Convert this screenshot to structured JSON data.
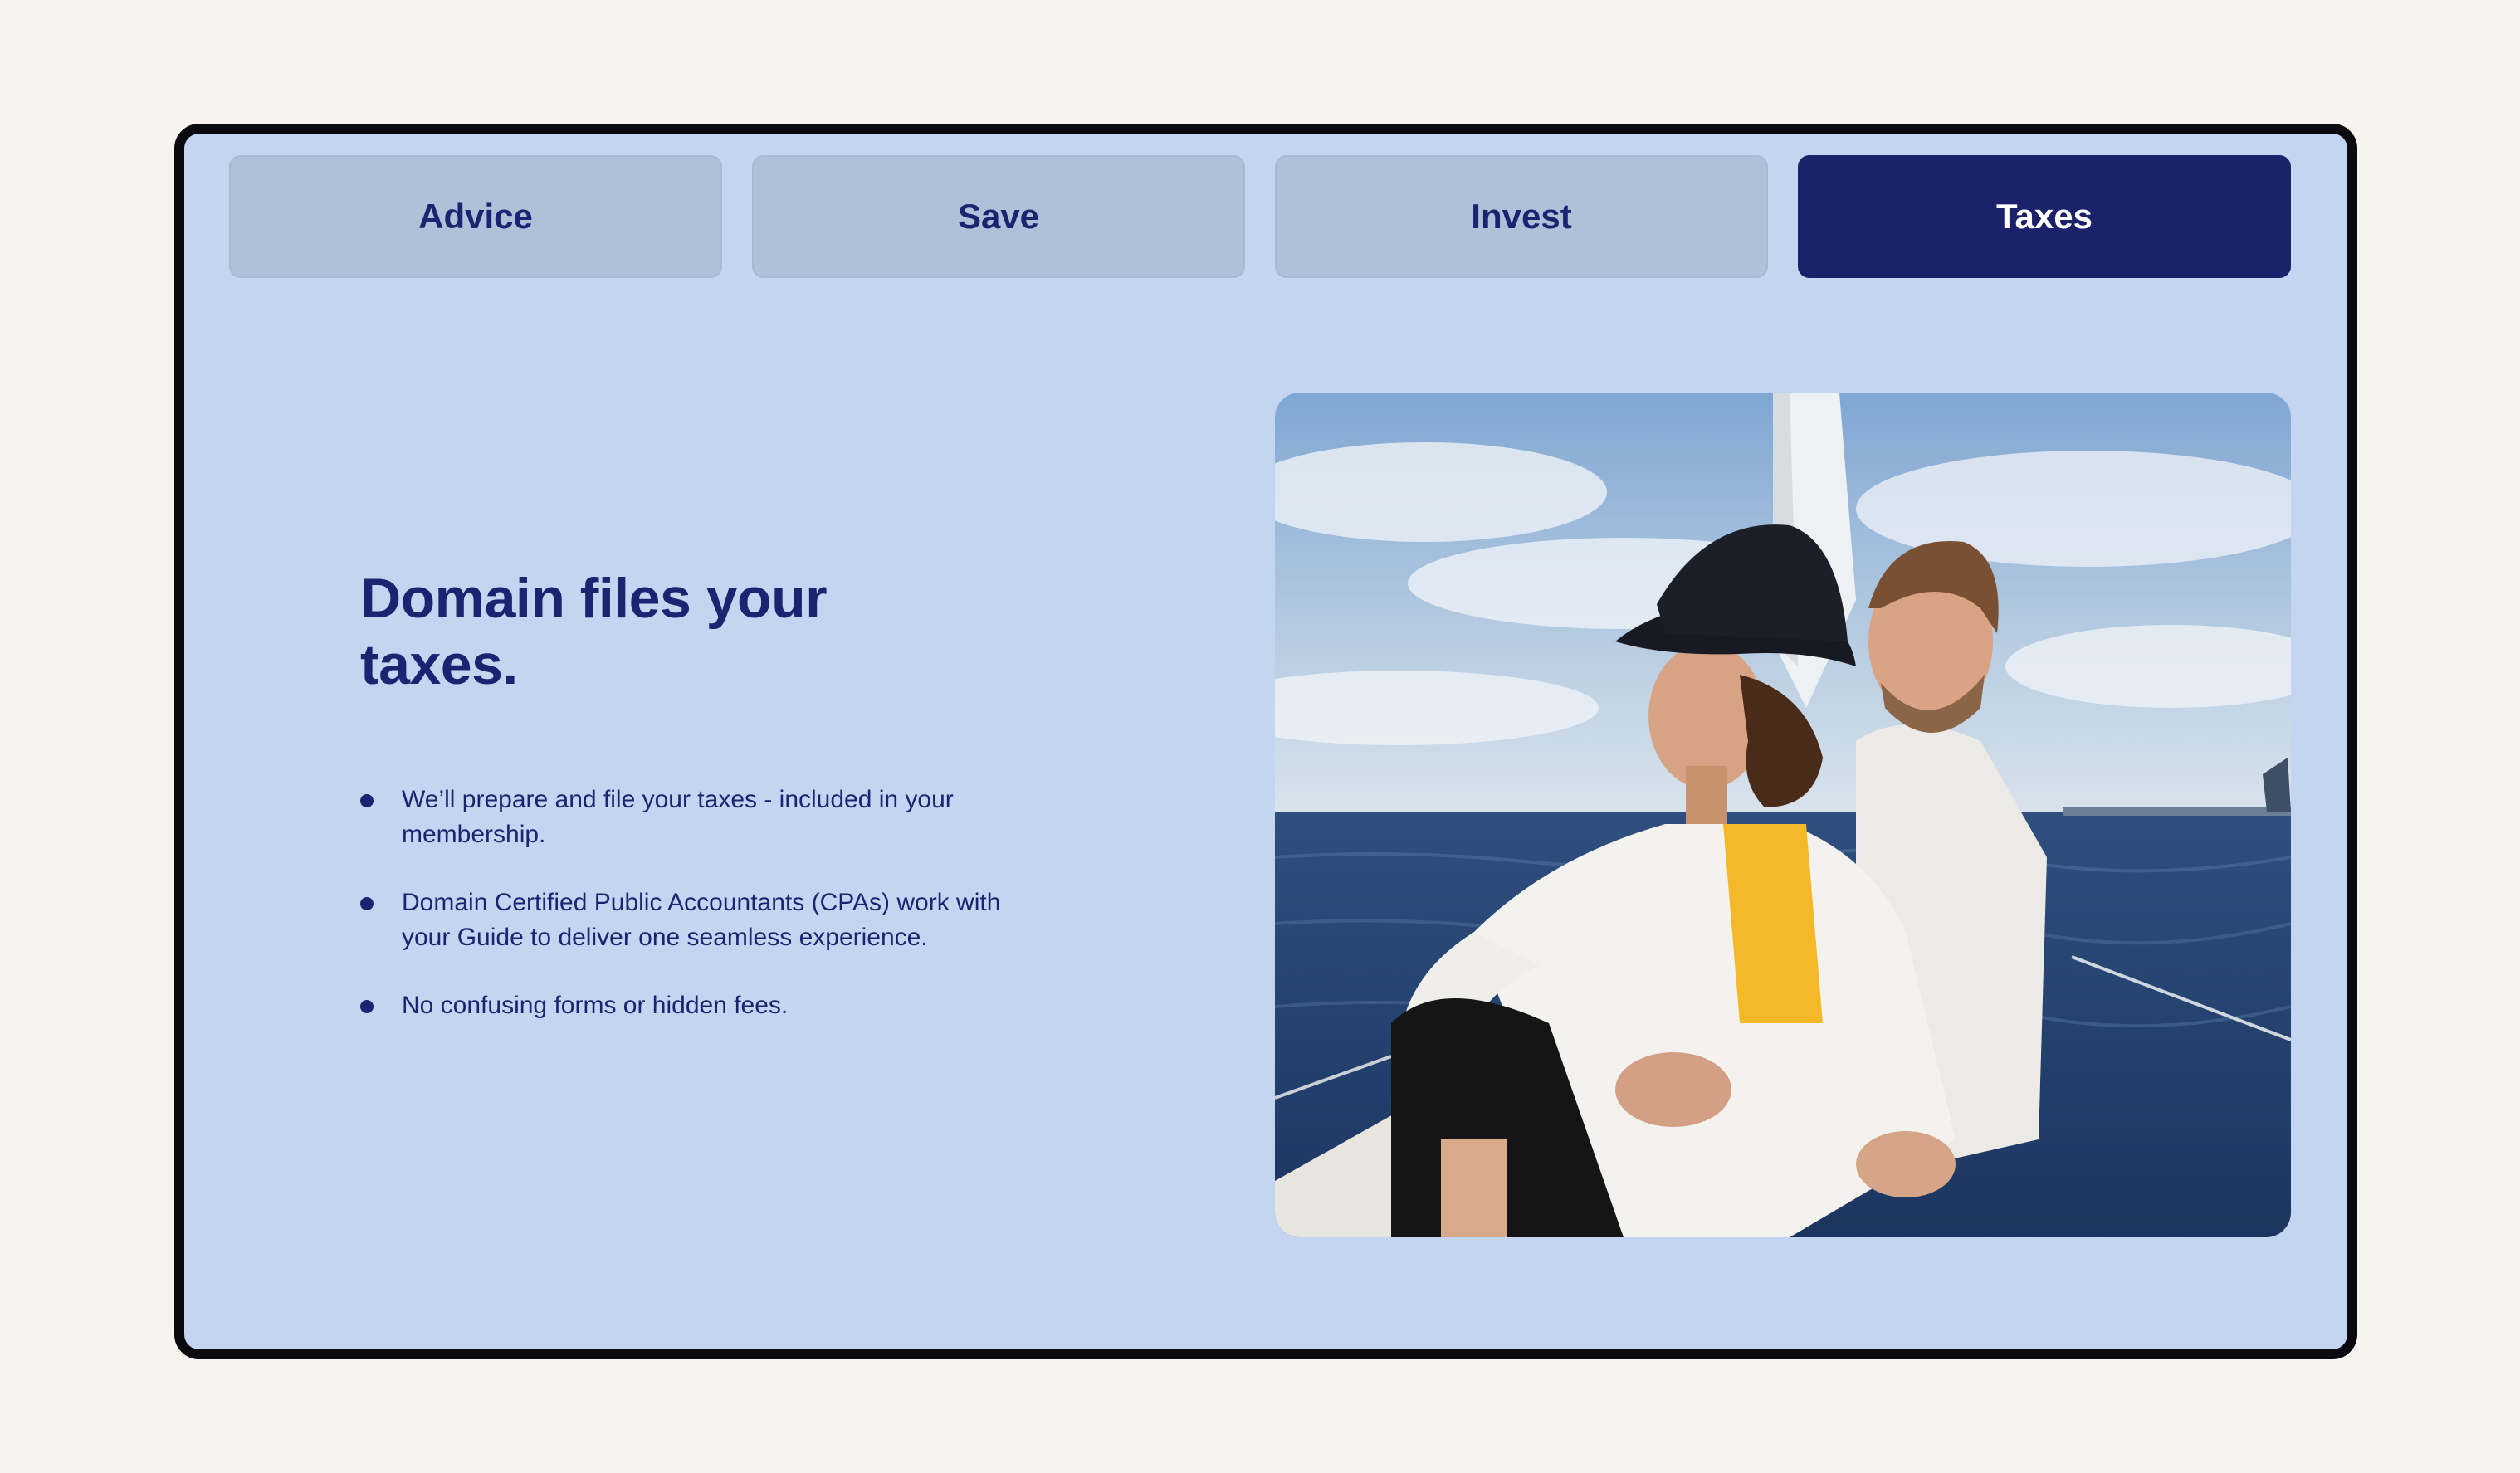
{
  "tabs": [
    {
      "label": "Advice",
      "active": false
    },
    {
      "label": "Save",
      "active": false
    },
    {
      "label": "Invest",
      "active": false
    },
    {
      "label": "Taxes",
      "active": true
    }
  ],
  "headline": "Domain files your taxes.",
  "bullets": [
    "We’ll prepare and file your taxes - included in your membership.",
    "Domain Certified Public Accountants (CPAs) work with your Guide to deliver one seamless experience.",
    "No confusing forms or hidden fees."
  ],
  "colors": {
    "page_background": "#f7f4ef",
    "panel": "#c4d5f1",
    "tab_inactive": "#afc0d9",
    "tab_active": "#1b216a",
    "text_navy": "#1b2470"
  },
  "image": {
    "alt": "Couple sitting on a sailboat at sea"
  }
}
